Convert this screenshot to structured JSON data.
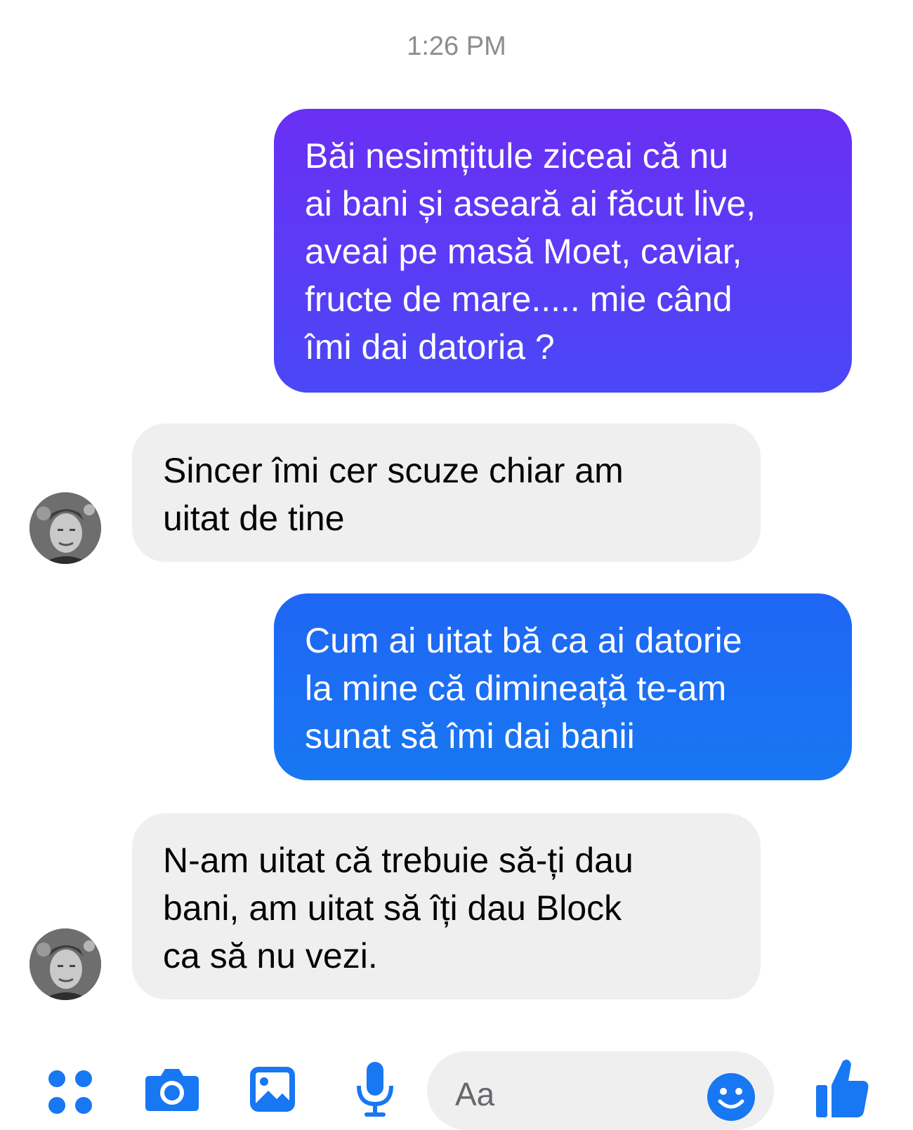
{
  "conversation": {
    "timestamp": "1:26 PM",
    "messages": [
      {
        "direction": "outgoing",
        "text": "Băi nesimțitule ziceai că nu\nai bani și aseară ai făcut live,\naveai pe masă Moet, caviar,\nfructe de mare..... mie când\nîmi dai datoria ?"
      },
      {
        "direction": "incoming",
        "text": "Sincer îmi cer scuze chiar am\nuitat de tine"
      },
      {
        "direction": "outgoing",
        "text": "Cum ai uitat bă ca ai datorie\nla mine că dimineață te-am\nsunat să îmi dai banii"
      },
      {
        "direction": "incoming",
        "text": "N-am uitat că trebuie să-ți dau\nbani, am uitat să îți dau Block\nca să nu vezi."
      }
    ]
  },
  "composer": {
    "placeholder": "Aa",
    "icons": [
      "more-apps-icon",
      "camera-icon",
      "gallery-icon",
      "microphone-icon",
      "emoji-icon",
      "thumbs-up-icon"
    ]
  },
  "colors": {
    "accent_blue": "#1877f2",
    "accent_purple": "#6a2ff4",
    "incoming_bubble": "#efefef"
  }
}
